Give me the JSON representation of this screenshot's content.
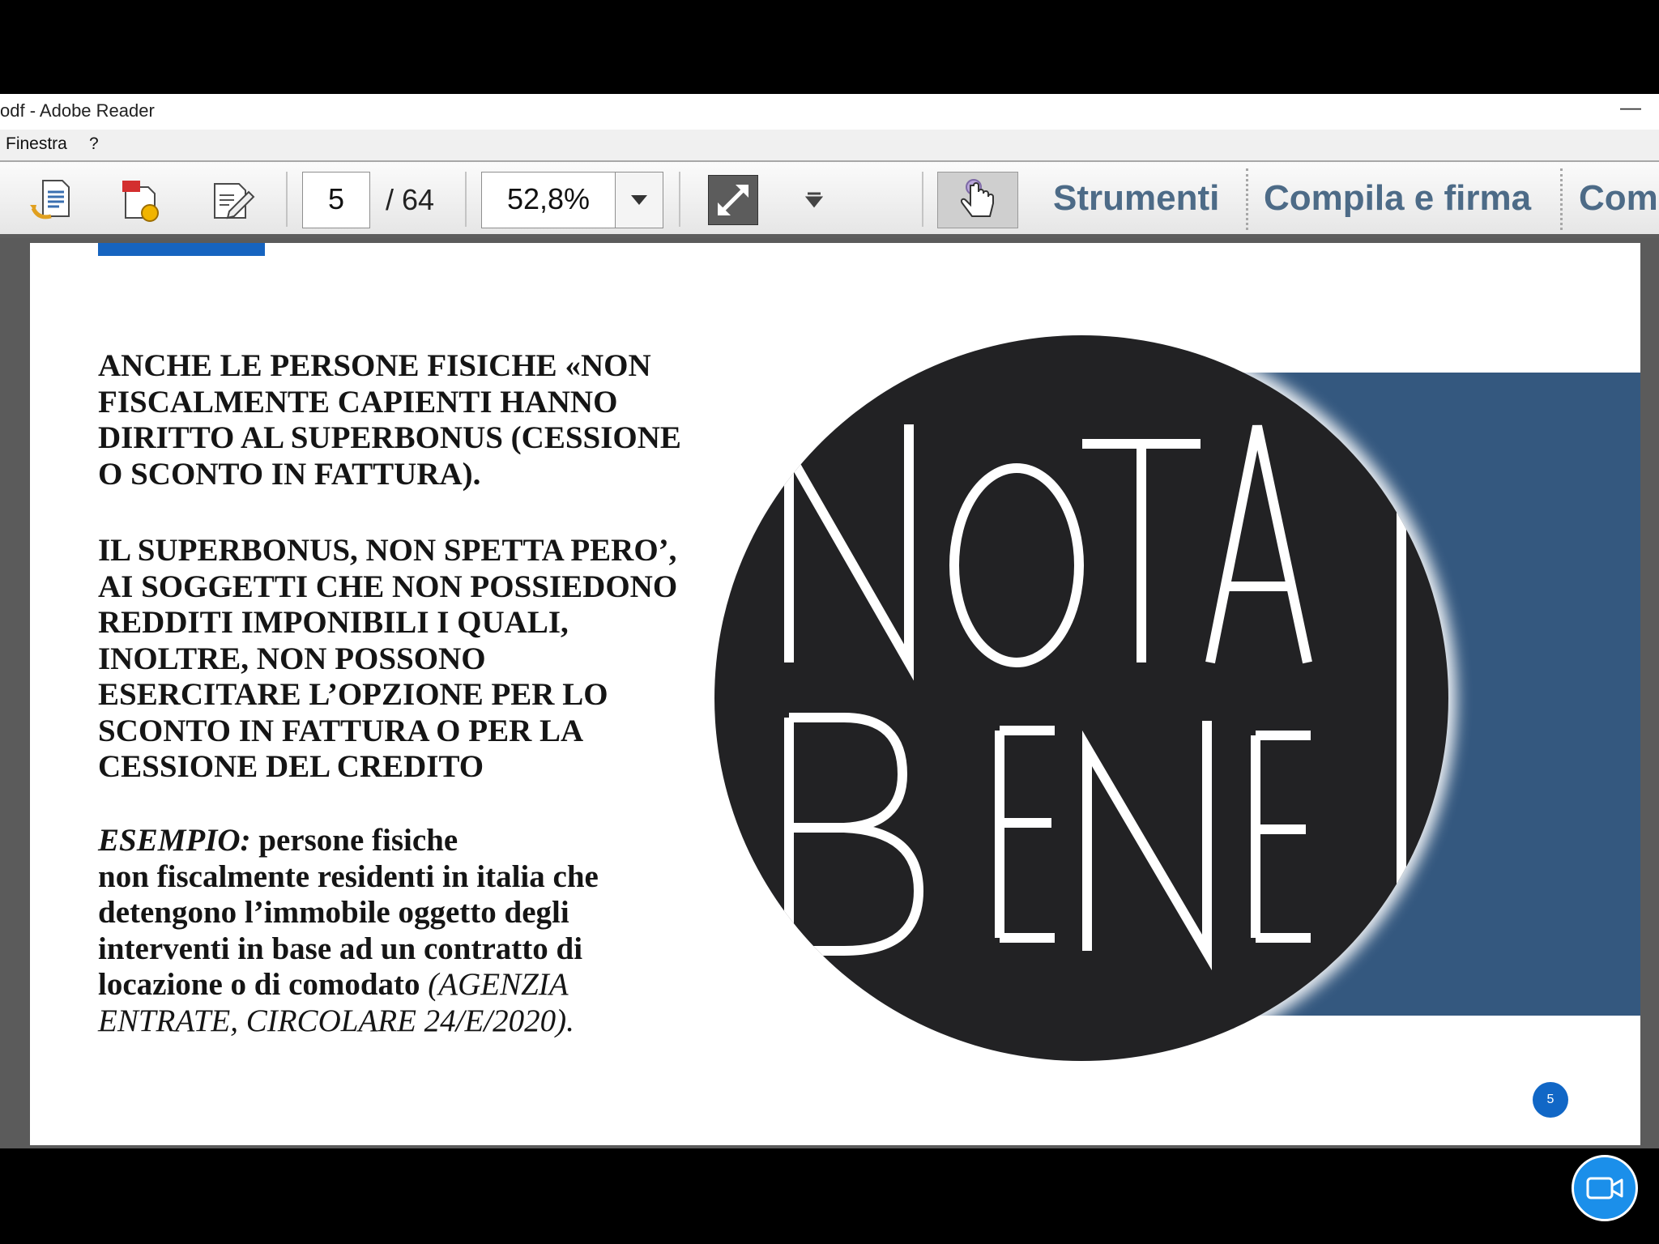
{
  "window": {
    "title": "odf - Adobe Reader",
    "minimize_glyph": "—"
  },
  "menubar": {
    "items": [
      "Finestra",
      "?"
    ]
  },
  "toolbar": {
    "page_current": "5",
    "page_total": "/ 64",
    "zoom": "52,8%",
    "links": [
      "Strumenti",
      "Compila e firma",
      "Com"
    ],
    "icons": [
      "open-document-icon",
      "create-pdf-icon",
      "edit-document-icon",
      "zoom-dropdown-icon",
      "fit-page-icon",
      "more-tools-icon",
      "hand-tool-icon"
    ]
  },
  "document": {
    "para1": "ANCHE LE PERSONE FISICHE «NON\nFISCALMENTE CAPIENTI HANNO\nDIRITTO AL SUPERBONUS (CESSIONE\nO SCONTO IN FATTURA).",
    "para2": "IL SUPERBONUS, NON SPETTA PERO’,\nAI SOGGETTI CHE NON POSSIEDONO\nREDDITI IMPONIBILI I QUALI,\nINOLTRE, NON POSSONO\nESERCITARE L’OPZIONE PER LO\nSCONTO IN FATTURA O PER LA\nCESSIONE DEL CREDITO",
    "example_label": "ESEMPIO:",
    "example_body": " persone fisiche\nnon fiscalmente residenti in italia che\ndetengono l’immobile oggetto degli\ninterventi in base ad un contratto di\nlocazione o di comodato",
    "example_citation": " (AGENZIA\nENTRATE, CIRCOLARE 24/E/2020).",
    "logo_text": "NOTA BENE",
    "page_number_badge": "5",
    "colors": {
      "circle": "#222224",
      "blue_panel": "#34587f",
      "badge": "#1167c6",
      "toolbar_link": "#4d6b87"
    }
  },
  "overlay": {
    "camera_icon": "video-camera-icon"
  }
}
